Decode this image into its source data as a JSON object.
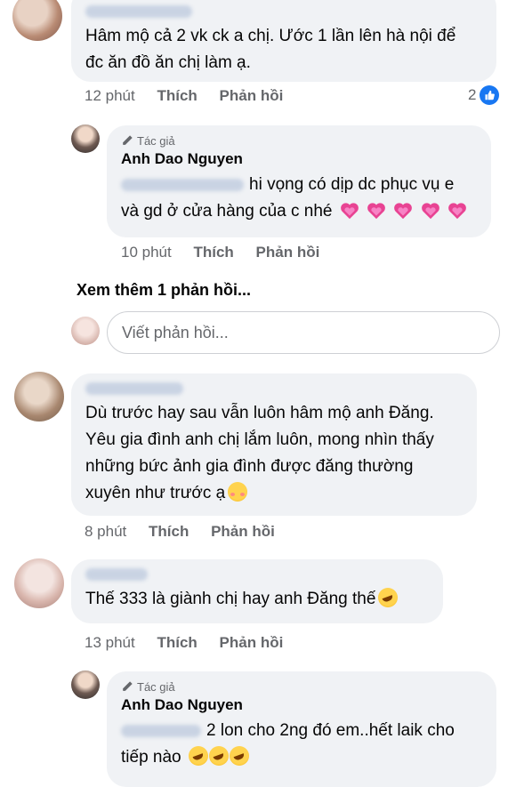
{
  "comments": [
    {
      "id": "c1",
      "author": "Nguyen Nhung",
      "text_lines": [
        "Hâm mộ cả 2 vk ck a chị. Ước 1 lần lên hà nội để",
        "đc ăn đồ ăn chị làm ạ."
      ],
      "time": "12 phút",
      "like_label": "Thích",
      "reply_label": "Phản hồi",
      "reaction_count": "2"
    },
    {
      "id": "r1",
      "author_badge": "Tác giả",
      "author": "Anh Dao Nguyen",
      "mention": "Nguyen Nhung",
      "text_line1": "hi vọng có dịp dc phục vụ e",
      "text_line2": "và gd ở cửa hàng của c nhé",
      "time": "10 phút",
      "like_label": "Thích",
      "reply_label": "Phản hồi"
    },
    {
      "id": "c2",
      "author": "Trần Hoài Thu",
      "text_lines": [
        "Dù trước hay sau vẫn luôn hâm mộ anh Đăng.",
        "Yêu gia đình anh chị lắm luôn, mong nhìn thấy",
        "những bức ảnh gia đình được đăng thường",
        "xuyên như trước ạ"
      ],
      "time": "8 phút",
      "like_label": "Thích",
      "reply_label": "Phản hồi"
    },
    {
      "id": "c3",
      "author": "Yen Anh",
      "text_lines": [
        "Thế 333 là giành chị hay anh Đăng thế"
      ],
      "time": "13 phút",
      "like_label": "Thích",
      "reply_label": "Phản hồi"
    },
    {
      "id": "r2",
      "author_badge": "Tác giả",
      "author": "Anh Dao Nguyen",
      "mention": "Yen Anh",
      "text_line1": "2 lon cho 2ng đó em..hết laik cho",
      "text_line2": "tiếp nào"
    }
  ],
  "more_replies": "Xem thêm 1 phản hồi...",
  "reply_input": {
    "placeholder": "Viết phản hồi..."
  },
  "colors": {
    "bubble": "#f0f2f5",
    "meta": "#65676b",
    "like_blue": "#1877f2",
    "heart": "#e84393"
  },
  "icons": [
    "pencil-icon",
    "like-reaction-icon",
    "heart-emoji",
    "rofl-emoji",
    "smiling-hearts-emoji"
  ]
}
